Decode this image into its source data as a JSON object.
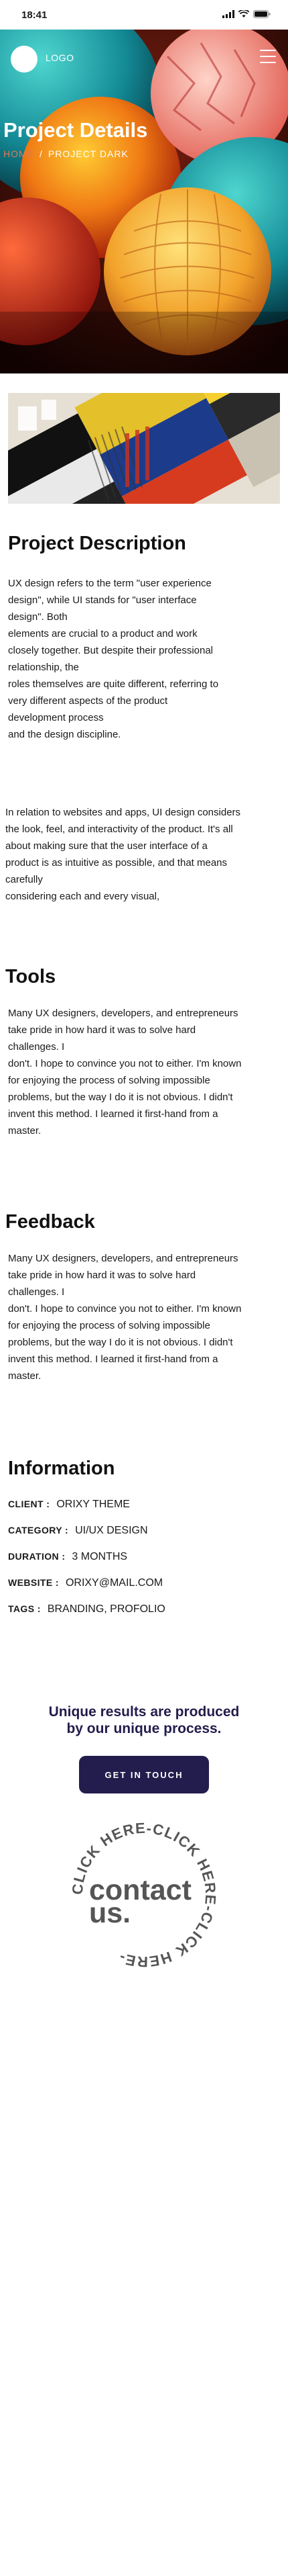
{
  "status_bar": {
    "time": "18:41"
  },
  "header": {
    "logo_text": "LOGO"
  },
  "hero": {
    "title": "Project Details",
    "breadcrumb_home": "HOME",
    "breadcrumb_separator": "/",
    "breadcrumb_current": "PROJECT DARK"
  },
  "description": {
    "heading": "Project Description",
    "paragraph_1": "UX design refers to the term \"user experience\ndesign\", while UI stands for \"user interface\ndesign\". Both\nelements are crucial to a product and work\nclosely together. But despite their professional\nrelationship, the\nroles themselves are quite different, referring to\nvery different aspects of the product\ndevelopment process\nand the design discipline.",
    "paragraph_2": "In relation to websites and apps, UI design considers\nthe look, feel, and interactivity of the product. It's all\nabout making sure that the user interface of a\nproduct is as intuitive as possible, and that means\ncarefully\nconsidering each and every visual,"
  },
  "tools": {
    "heading": "Tools",
    "paragraph": "Many UX designers, developers, and entrepreneurs\ntake pride in how hard it was to solve hard\nchallenges. I\ndon't. I hope to convince you not to either. I'm known\nfor enjoying the process of solving impossible\nproblems, but the way I do it is not obvious. I didn't\ninvent this method. I learned it first-hand from a\nmaster."
  },
  "feedback": {
    "heading": "Feedback",
    "paragraph": "Many UX designers, developers, and entrepreneurs\ntake pride in how hard it was to solve hard\nchallenges. I\ndon't. I hope to convince you not to either. I'm known\nfor enjoying the process of solving impossible\nproblems, but the way I do it is not obvious. I didn't\ninvent this method. I learned it first-hand from a\nmaster."
  },
  "information": {
    "heading": "Information",
    "rows": [
      {
        "label": "CLIENT :",
        "value": "ORIXY THEME"
      },
      {
        "label": "CATEGORY :",
        "value": "UI/UX DESIGN"
      },
      {
        "label": "DURATION :",
        "value": "3 MONTHS"
      },
      {
        "label": "WEBSITE :",
        "value": "ORIXY@MAIL.COM"
      },
      {
        "label": "TAGS :",
        "value": "BRANDING, PROFOLIO"
      }
    ]
  },
  "cta": {
    "title_line_1": "Unique results are produced",
    "title_line_2": "by our unique process.",
    "button_label": "GET IN TOUCH"
  },
  "badge": {
    "ring_text": "CLICK HERE-CLICK HERE-CLICK HERE-",
    "center_line_1": "contact",
    "center_line_2": "us."
  },
  "colors": {
    "accent_navy": "#221d4c",
    "breadcrumb_home": "#e07a52",
    "badge_grey": "#555555"
  }
}
